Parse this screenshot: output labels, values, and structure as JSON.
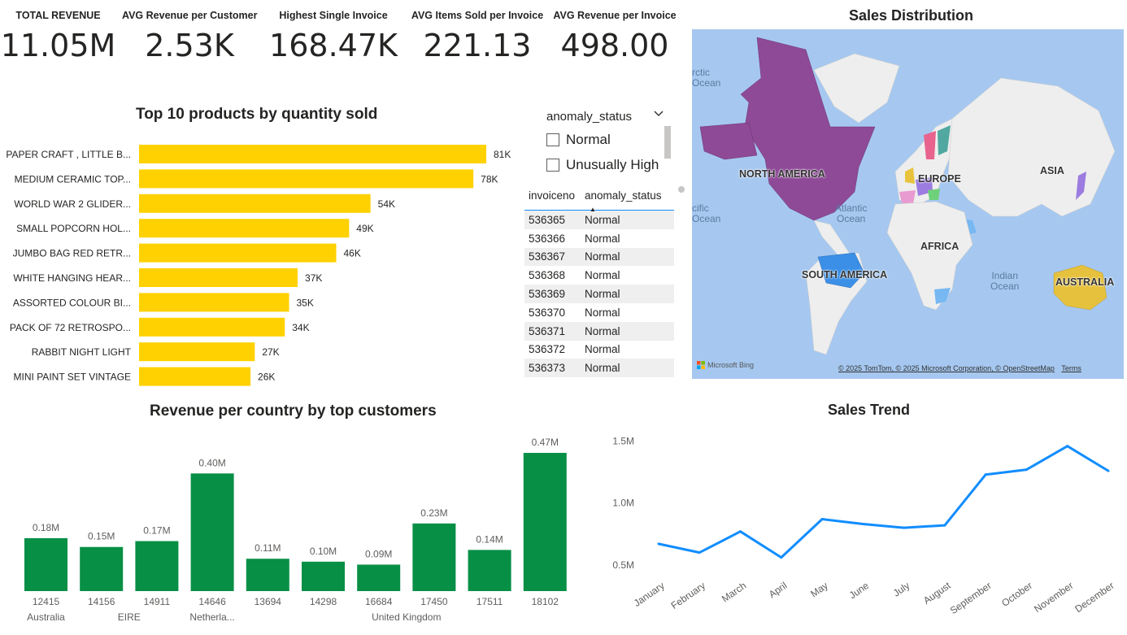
{
  "kpis": [
    {
      "label": "TOTAL REVENUE",
      "value": "11.05M"
    },
    {
      "label": "AVG Revenue per Customer",
      "value": "2.53K"
    },
    {
      "label": "Highest Single Invoice",
      "value": "168.47K"
    },
    {
      "label": "AVG Items Sold per Invoice",
      "value": "221.13"
    },
    {
      "label": "AVG Revenue per Invoice",
      "value": "498.00"
    }
  ],
  "top_products": {
    "title": "Top 10 products by quantity sold",
    "bar_color": "#ffd100"
  },
  "slicer": {
    "title": "anomaly_status",
    "options": [
      "Normal",
      "Unusually High"
    ]
  },
  "invoice_table": {
    "headers": [
      "invoiceno",
      "anomaly_status"
    ],
    "rows": [
      [
        "536365",
        "Normal"
      ],
      [
        "536366",
        "Normal"
      ],
      [
        "536367",
        "Normal"
      ],
      [
        "536368",
        "Normal"
      ],
      [
        "536369",
        "Normal"
      ],
      [
        "536370",
        "Normal"
      ],
      [
        "536371",
        "Normal"
      ],
      [
        "536372",
        "Normal"
      ],
      [
        "536373",
        "Normal"
      ]
    ]
  },
  "map": {
    "title": "Sales Distribution",
    "continents": [
      "NORTH AMERICA",
      "EUROPE",
      "ASIA",
      "AFRICA",
      "SOUTH AMERICA",
      "AUSTRALIA"
    ],
    "oceans": [
      "rctic\nOcean",
      "Atlantic\nOcean",
      "cific\nOcean",
      "Indian\nOcean"
    ],
    "brand": "Microsoft Bing",
    "attribution": "© 2025 TomTom, © 2025 Microsoft Corporation, © OpenStreetMap",
    "terms": "Terms"
  },
  "country_revenue": {
    "title": "Revenue per country by top customers",
    "bar_color": "#078f46"
  },
  "sales_trend": {
    "title": "Sales Trend",
    "line_color": "#118dff"
  },
  "chart_data": [
    {
      "type": "bar",
      "orientation": "horizontal",
      "title": "Top 10 products by quantity sold",
      "categories": [
        "PAPER CRAFT , LITTLE B...",
        "MEDIUM CERAMIC TOP...",
        "WORLD WAR 2 GLIDER...",
        "SMALL POPCORN HOL...",
        "JUMBO BAG RED RETR...",
        "WHITE HANGING HEAR...",
        "ASSORTED COLOUR BI...",
        "PACK OF 72 RETROSPO...",
        "RABBIT NIGHT LIGHT",
        "MINI PAINT SET VINTAGE"
      ],
      "values": [
        81,
        78,
        54,
        49,
        46,
        37,
        35,
        34,
        27,
        26
      ],
      "data_labels": [
        "81K",
        "78K",
        "54K",
        "49K",
        "46K",
        "37K",
        "35K",
        "34K",
        "27K",
        "26K"
      ],
      "xlim": [
        0,
        81
      ]
    },
    {
      "type": "bar",
      "title": "Revenue per country by top customers",
      "categories": [
        "12415",
        "14156",
        "14911",
        "14646",
        "13694",
        "14298",
        "16684",
        "17450",
        "17511",
        "18102"
      ],
      "groups": [
        {
          "label": "Australia",
          "span": [
            0,
            0
          ]
        },
        {
          "label": "EIRE",
          "span": [
            1,
            2
          ]
        },
        {
          "label": "Netherla...",
          "span": [
            3,
            3
          ]
        },
        {
          "label": "United Kingdom",
          "span": [
            4,
            9
          ]
        }
      ],
      "values": [
        0.18,
        0.15,
        0.17,
        0.4,
        0.11,
        0.1,
        0.09,
        0.23,
        0.14,
        0.47
      ],
      "data_labels": [
        "0.18M",
        "0.15M",
        "0.17M",
        "0.40M",
        "0.11M",
        "0.10M",
        "0.09M",
        "0.23M",
        "0.14M",
        "0.47M"
      ],
      "ylim": [
        0,
        0.47
      ]
    },
    {
      "type": "line",
      "title": "Sales Trend",
      "x": [
        "January",
        "February",
        "March",
        "April",
        "May",
        "June",
        "July",
        "August",
        "September",
        "October",
        "November",
        "December"
      ],
      "y": [
        0.67,
        0.6,
        0.77,
        0.56,
        0.87,
        0.83,
        0.8,
        0.82,
        1.23,
        1.27,
        1.46,
        1.26
      ],
      "yticks": [
        "0.5M",
        "1.0M",
        "1.5M"
      ],
      "ytick_values": [
        0.5,
        1.0,
        1.5
      ],
      "ylim": [
        0.4,
        1.53
      ]
    }
  ]
}
